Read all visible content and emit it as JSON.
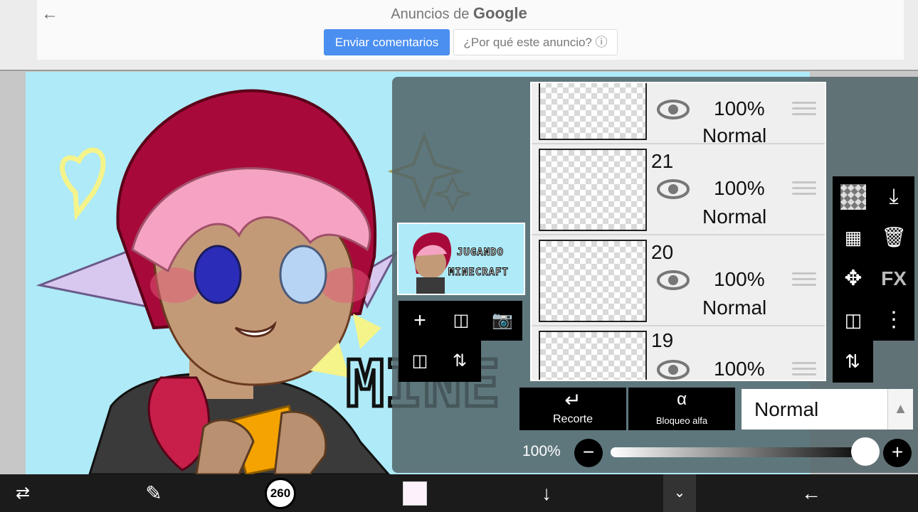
{
  "ad": {
    "title_prefix": "Anuncios de ",
    "title_brand": "Google",
    "feedback_button": "Enviar comentarios",
    "why_button": "¿Por qué este anuncio? ⓘ"
  },
  "thumbnail": {
    "line1": "JUGANDO",
    "line2": "MINECRAFT"
  },
  "layers": [
    {
      "number": "",
      "opacity": "100%",
      "mode": "Normal"
    },
    {
      "number": "21",
      "opacity": "100%",
      "mode": "Normal"
    },
    {
      "number": "20",
      "opacity": "100%",
      "mode": "Normal"
    },
    {
      "number": "19",
      "opacity": "100%",
      "mode": ""
    }
  ],
  "buttons": {
    "clipping": "Recorte",
    "alpha_lock": "Bloqueo alfa",
    "fx": "FX"
  },
  "blend_mode": "Normal",
  "opacity": {
    "label": "100%",
    "value": 1.0
  },
  "brush_size": "260",
  "colors": {
    "panel": "#50646a",
    "canvas_bg": "#aeeaf7",
    "accent_google": "#4b8ff0"
  }
}
